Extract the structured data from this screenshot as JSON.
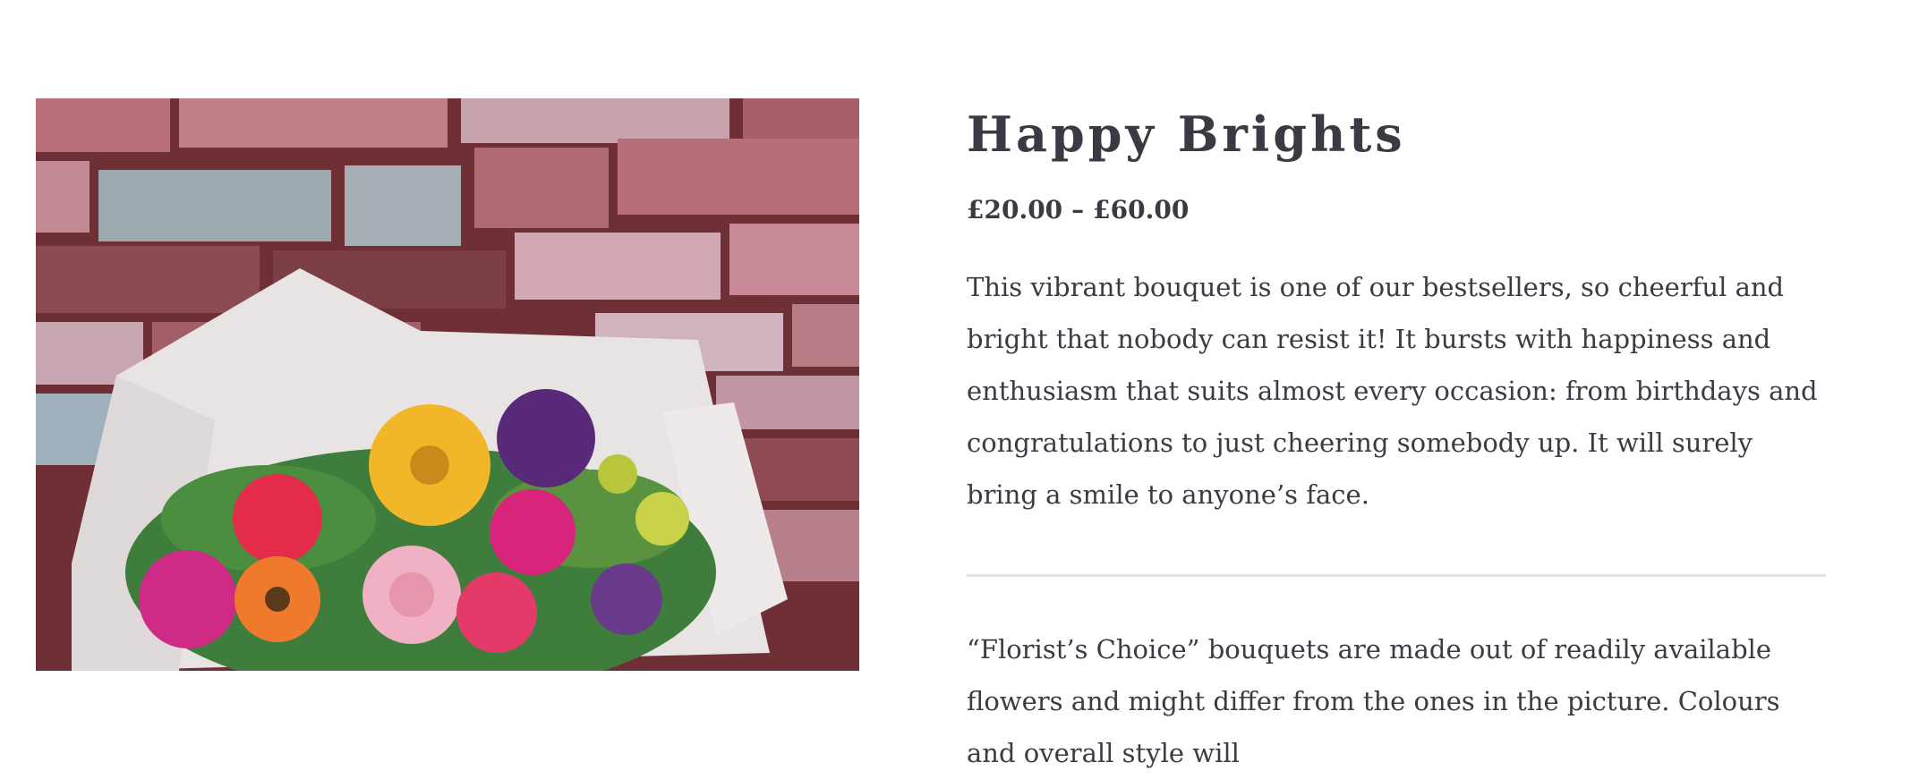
{
  "product": {
    "title": "Happy Brights",
    "price_min": "£20.00",
    "price_separator": "–",
    "price_max": "£60.00",
    "description": "This vibrant bouquet is one of our bestsellers, so cheerful and bright that nobody can resist it! It bursts with happiness and enthusiasm that suits almost every occasion: from birthdays and congratulations to just cheering somebody up. It will surely bring a smile to anyone’s face.",
    "florist_note": "“Florist’s Choice” bouquets are made out of readily available flowers and might differ from the ones in the picture. Colours and overall style will"
  }
}
